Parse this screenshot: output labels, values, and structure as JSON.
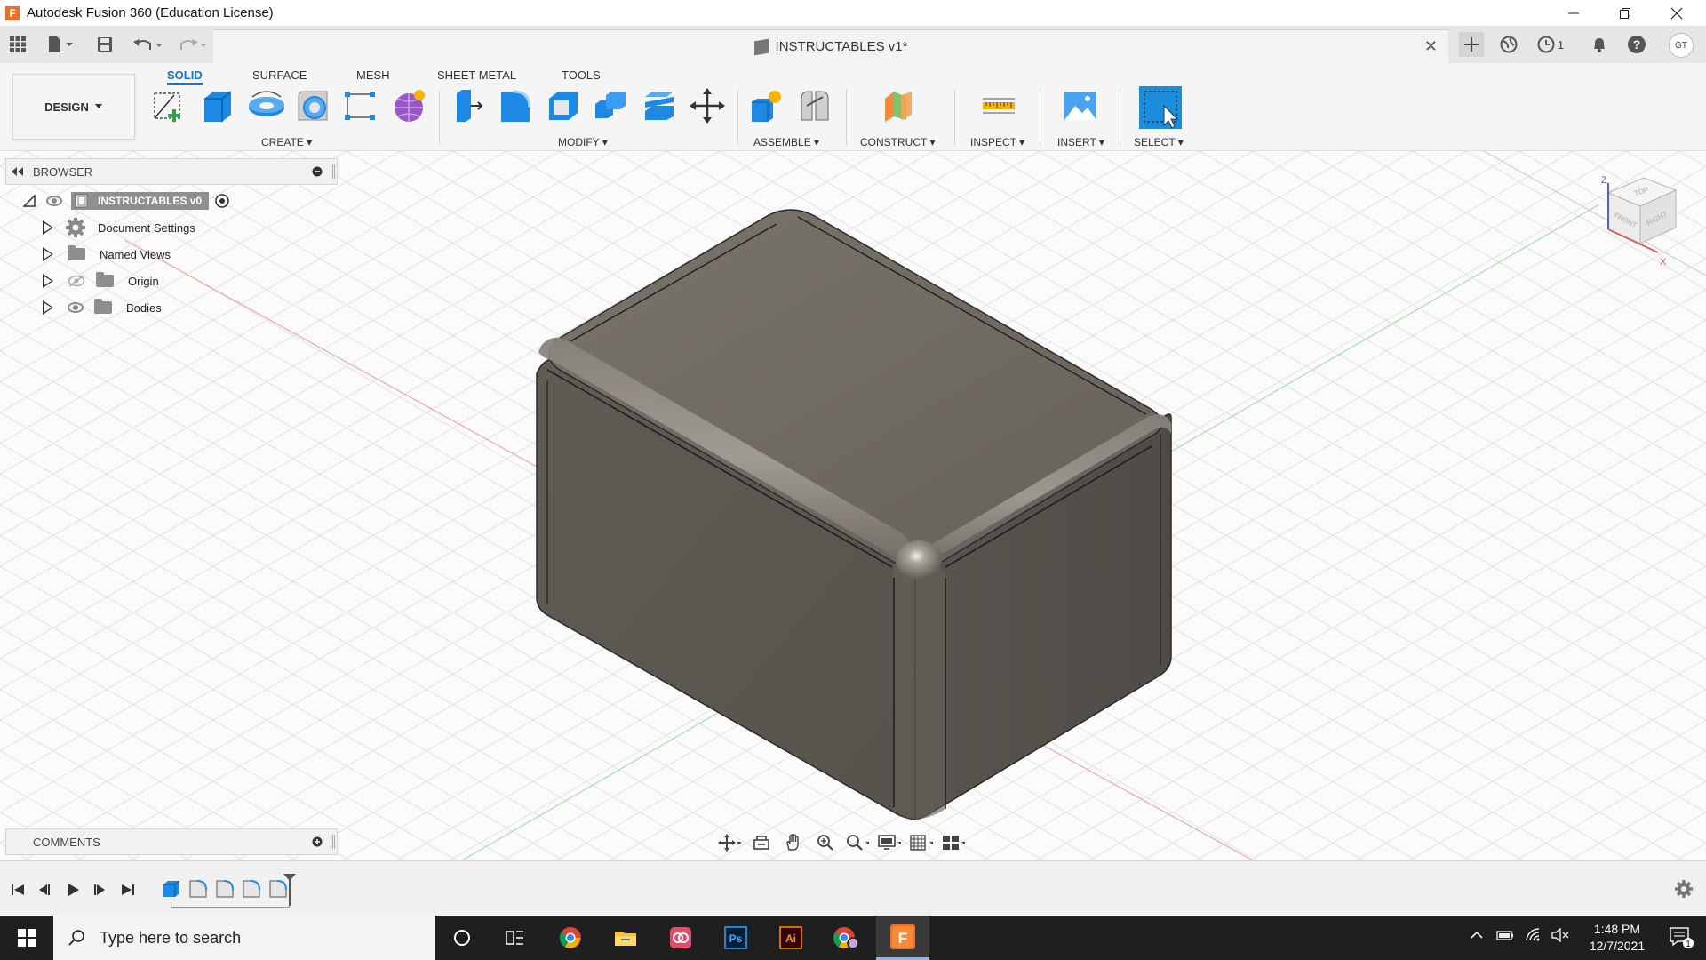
{
  "window": {
    "title": "Autodesk Fusion 360 (Education License)",
    "logo_letter": "F"
  },
  "tabbar": {
    "document_tab": "INSTRUCTABLES v1*",
    "close_glyph": "✕",
    "notifications_count": "1",
    "user_initials": "GT"
  },
  "toolbar": {
    "workspace": "DESIGN",
    "tabs": [
      "SOLID",
      "SURFACE",
      "MESH",
      "SHEET METAL",
      "TOOLS"
    ],
    "active_tab": "SOLID",
    "groups": {
      "create": "CREATE",
      "modify": "MODIFY",
      "assemble": "ASSEMBLE",
      "construct": "CONSTRUCT",
      "inspect": "INSPECT",
      "insert": "INSERT",
      "select": "SELECT"
    }
  },
  "browser": {
    "title": "BROWSER",
    "root": "INSTRUCTABLES v0",
    "items": [
      {
        "label": "Document Settings",
        "icon": "gear-icon"
      },
      {
        "label": "Named Views",
        "icon": "folder-icon"
      },
      {
        "label": "Origin",
        "icon": "folder-icon"
      },
      {
        "label": "Bodies",
        "icon": "folder-icon"
      }
    ]
  },
  "comments": {
    "title": "COMMENTS"
  },
  "viewcube": {
    "faces": [
      "TOP",
      "FRONT",
      "RIGHT"
    ],
    "axes": [
      "Z",
      "X"
    ]
  },
  "taskbar": {
    "search_placeholder": "Type here to search",
    "time": "1:48 PM",
    "date": "12/7/2021",
    "notification_count": "1",
    "apps": [
      "task-view",
      "chrome",
      "file-explorer",
      "creative-cloud",
      "photoshop",
      "illustrator",
      "chrome-profile",
      "fusion-360"
    ]
  },
  "colors": {
    "accent": "#1a73c8",
    "body": "#6b665c",
    "fusion_orange": "#f06d22"
  }
}
